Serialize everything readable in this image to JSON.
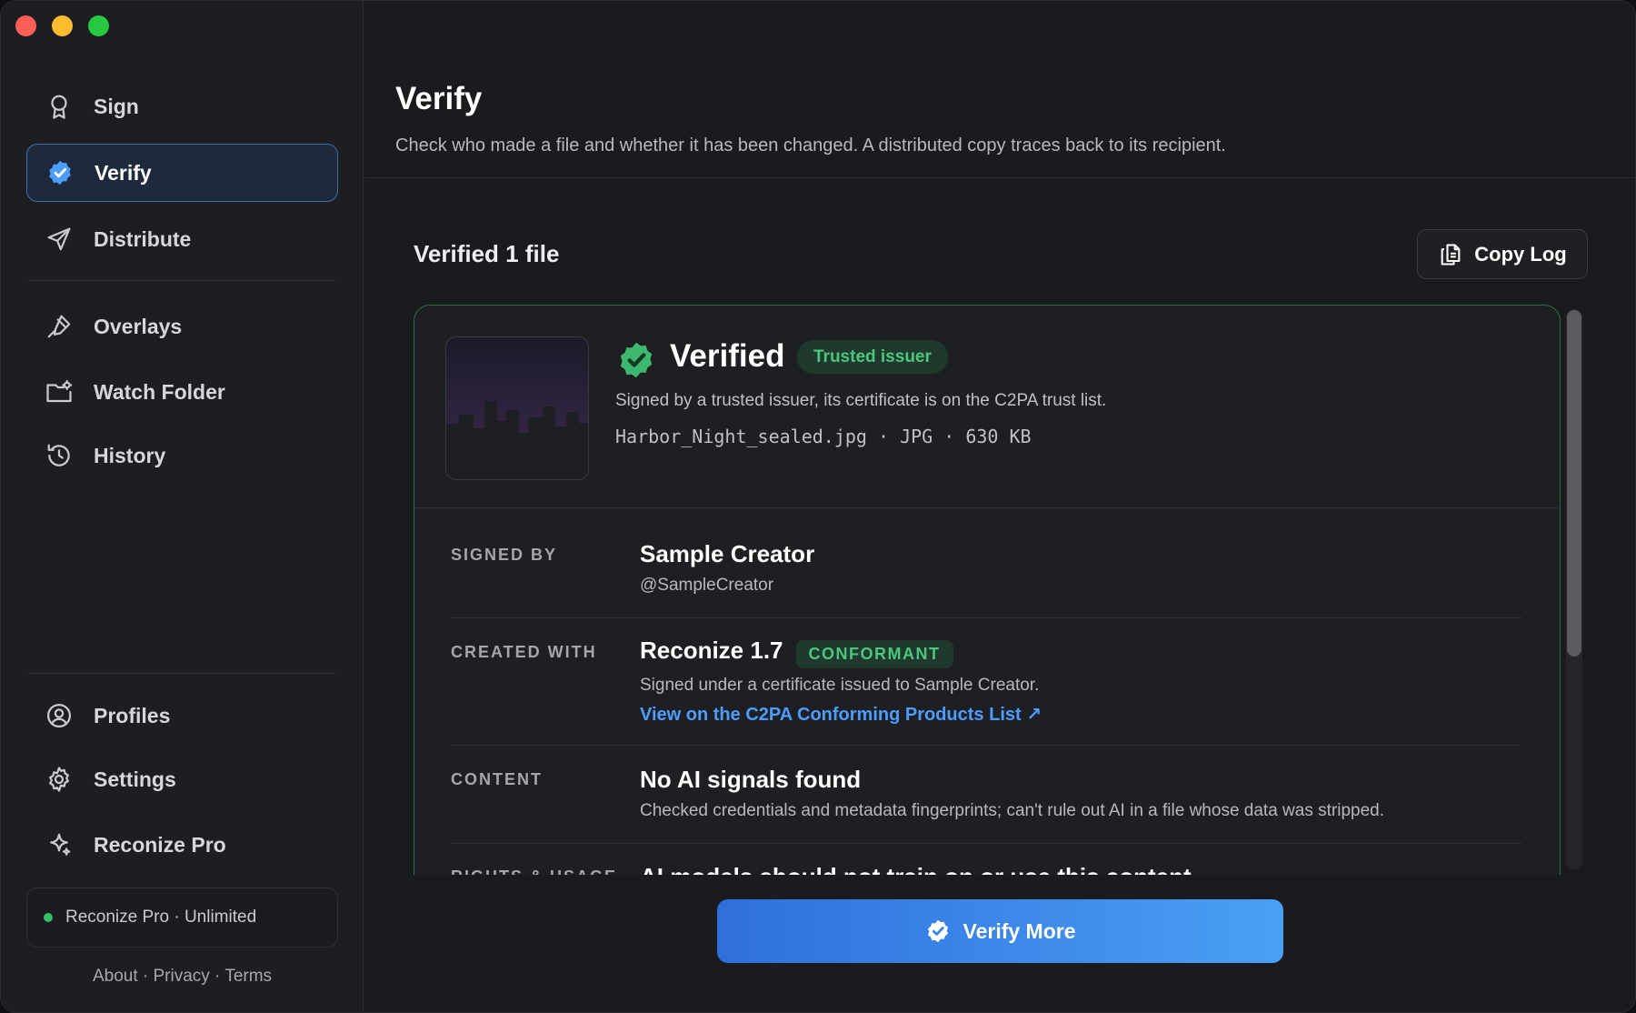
{
  "sidebar": {
    "nav": [
      {
        "label": "Sign",
        "icon": "ribbon-icon"
      },
      {
        "label": "Verify",
        "icon": "verified-badge-icon"
      },
      {
        "label": "Distribute",
        "icon": "send-icon"
      },
      {
        "label": "Overlays",
        "icon": "pen-icon"
      },
      {
        "label": "Watch Folder",
        "icon": "folder-gear-icon"
      },
      {
        "label": "History",
        "icon": "history-icon"
      },
      {
        "label": "Profiles",
        "icon": "profile-icon"
      },
      {
        "label": "Settings",
        "icon": "gear-icon"
      },
      {
        "label": "Reconize Pro",
        "icon": "sparkle-icon"
      }
    ],
    "active": "Verify",
    "plan": "Reconize Pro · Unlimited",
    "footer": "About · Privacy · Terms"
  },
  "header": {
    "title": "Verify",
    "subtitle": "Check who made a file and whether it has been changed. A distributed copy traces back to its recipient."
  },
  "results": {
    "count_label": "Verified 1 file",
    "copy_log": "Copy Log"
  },
  "card": {
    "status": "Verified",
    "badge": "Trusted issuer",
    "description": "Signed by a trusted issuer, its certificate is on the C2PA trust list.",
    "file_info": "Harbor_Night_sealed.jpg · JPG · 630 KB",
    "rows": {
      "signed_by": {
        "label": "SIGNED BY",
        "name": "Sample Creator",
        "handle": "@SampleCreator"
      },
      "created_with": {
        "label": "CREATED WITH",
        "name": "Reconize 1.7",
        "badge": "CONFORMANT",
        "note": "Signed under a certificate issued to Sample Creator.",
        "link": "View on the C2PA Conforming Products List ↗"
      },
      "content": {
        "label": "CONTENT",
        "title": "No AI signals found",
        "note": "Checked credentials and metadata fingerprints; can't rule out AI in a file whose data was stripped."
      },
      "rights": {
        "label": "RIGHTS & USAGE",
        "title": "AI models should not train on or use this content"
      }
    }
  },
  "verify_more": "Verify More",
  "colors": {
    "accent": "#4c9dff",
    "success": "#4cc57d",
    "active_border": "#3d6fb0"
  }
}
